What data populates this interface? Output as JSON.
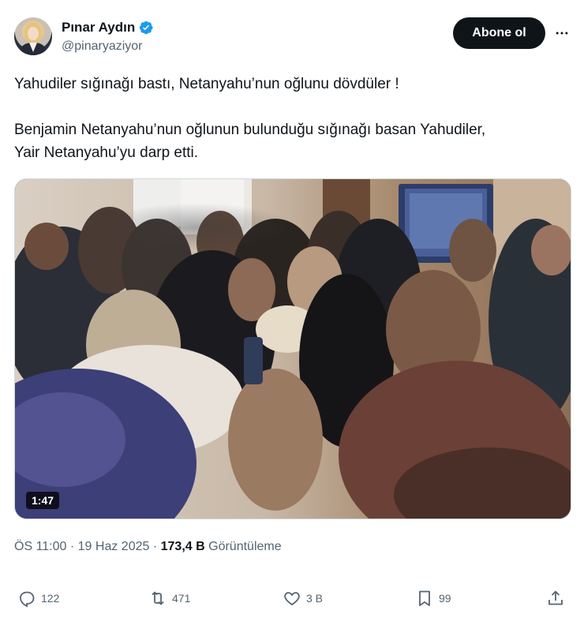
{
  "author": {
    "display_name": "Pınar Aydın",
    "handle": "@pinaryaziyor",
    "verified": true
  },
  "header": {
    "follow_label": "Abone ol",
    "more_icon": "more-horizontal-icon"
  },
  "tweet": {
    "line1": "Yahudiler sığınağı bastı, Netanyahu’nun oğlunu dövdüler !",
    "line2": "Benjamin Netanyahu’nun oğlunun bulunduğu sığınağı basan Yahudiler,",
    "line3": "Yair Netanyahu’yu darp etti."
  },
  "media": {
    "type": "video",
    "duration": "1:47"
  },
  "meta": {
    "time": "ÖS 11:00",
    "separator1": "·",
    "date": "19 Haz 2025",
    "separator2": "·",
    "views_count": "173,4 B",
    "views_label": "Görüntüleme"
  },
  "actions": {
    "reply": {
      "icon": "reply-icon",
      "count": "122"
    },
    "retweet": {
      "icon": "retweet-icon",
      "count": "471"
    },
    "like": {
      "icon": "heart-icon",
      "count": "3 B"
    },
    "bookmark": {
      "icon": "bookmark-icon",
      "count": "99"
    },
    "share": {
      "icon": "share-icon"
    }
  },
  "colors": {
    "text": "#0f1419",
    "secondary": "#536471",
    "verified": "#1d9bf0",
    "button_bg": "#0f1419"
  }
}
